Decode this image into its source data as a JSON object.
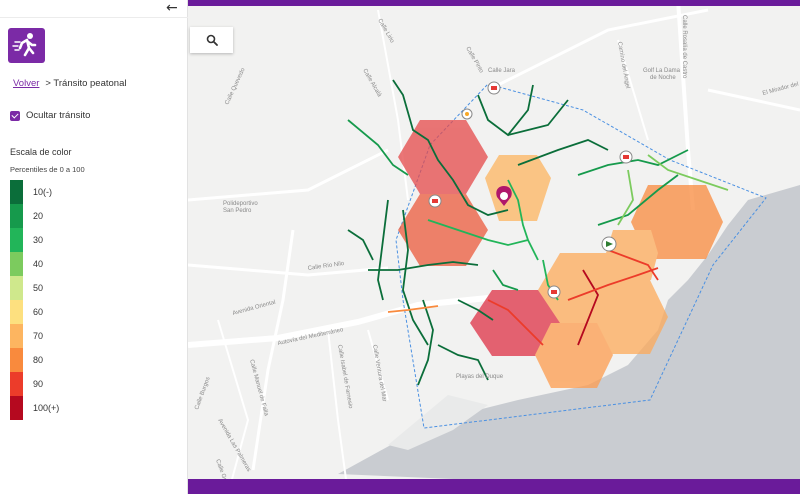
{
  "sidebar": {
    "back_icon": "arrow-left-icon",
    "mode_icon": "walking-person-icon",
    "breadcrumb": {
      "back_link": "Volver",
      "current": "> Tránsito peatonal"
    },
    "toggle": {
      "label": "Ocultar tránsito",
      "checked": true
    },
    "scale": {
      "title": "Escala de color",
      "subtitle": "Percentiles de 0 a 100",
      "items": [
        {
          "label": "10(-)",
          "color": "#0b6e3a"
        },
        {
          "label": "20",
          "color": "#169a4c"
        },
        {
          "label": "30",
          "color": "#22b559"
        },
        {
          "label": "40",
          "color": "#7ccb5e"
        },
        {
          "label": "50",
          "color": "#cfe88c"
        },
        {
          "label": "60",
          "color": "#fde07f"
        },
        {
          "label": "70",
          "color": "#fdb560"
        },
        {
          "label": "80",
          "color": "#f98a3d"
        },
        {
          "label": "90",
          "color": "#ec3c2a"
        },
        {
          "label": "100(+)",
          "color": "#b5091f"
        }
      ]
    }
  },
  "map": {
    "search_icon": "search-icon",
    "accent_color": "#6a1b9a",
    "labels": [
      "Calle Lirio",
      "Calle Alcalá",
      "Calle Pinto",
      "Calle Jara",
      "Calle Rosalía de Castro",
      "Camino del Ángel",
      "Calle Quevedo",
      "Polideportivo San Pedro",
      "Calle Río Nilo",
      "Avenida Oriental",
      "Autovía del Mediterráneo",
      "Calle Burgos",
      "Avenida Las Palmeras",
      "Calle Manuel de Falla",
      "Calle Isabel de Farnesio",
      "Calle Ventura del Mar",
      "Playas del Duque",
      "Golf La Dama de Noche",
      "El Mirador del Golf",
      "Calle Guadiaro"
    ]
  }
}
